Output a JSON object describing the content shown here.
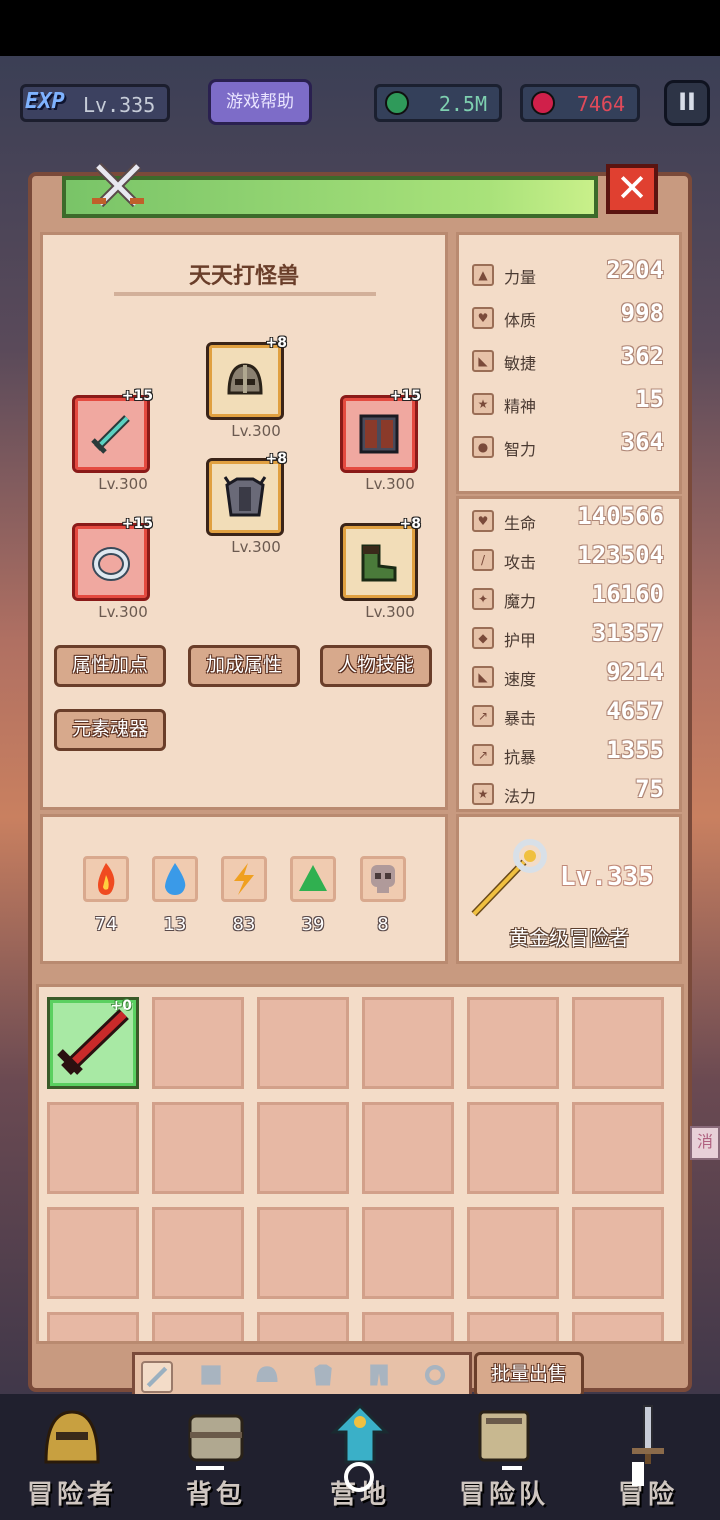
{
  "topbar": {
    "exp_tag": "EXP",
    "level": "Lv.335",
    "help_label": "游戏帮助",
    "gems": "2.5M",
    "gems_color": "#2f9a5a",
    "rubies": "7464",
    "rubies_color": "#d0204a",
    "pause_label": "II"
  },
  "hero": {
    "name": "天天打怪兽",
    "close_label": "✕"
  },
  "equipment": [
    {
      "slot": "helmet",
      "plus": "+8",
      "level": "Lv.300"
    },
    {
      "slot": "weapon",
      "plus": "+15",
      "level": "Lv.300"
    },
    {
      "slot": "shield",
      "plus": "+15",
      "level": "Lv.300"
    },
    {
      "slot": "armor",
      "plus": "+8",
      "level": "Lv.300"
    },
    {
      "slot": "ring",
      "plus": "+15",
      "level": "Lv.300"
    },
    {
      "slot": "boots",
      "plus": "+8",
      "level": "Lv.300"
    }
  ],
  "panel_buttons": {
    "attr_points": "属性加点",
    "bonus_attrs": "加成属性",
    "char_skills": "人物技能",
    "element_soul": "元素魂器"
  },
  "elements": [
    {
      "icon": "fire-icon",
      "value": "74",
      "color": "#f04a20"
    },
    {
      "icon": "water-icon",
      "value": "13",
      "color": "#3a9ae8"
    },
    {
      "icon": "lightning-icon",
      "value": "83",
      "color": "#f0a020"
    },
    {
      "icon": "earth-icon",
      "value": "39",
      "color": "#30b050"
    },
    {
      "icon": "dark-icon",
      "value": "8",
      "color": "#8a6a6a"
    }
  ],
  "attributes": [
    {
      "name": "力量",
      "value": "2204"
    },
    {
      "name": "体质",
      "value": "998"
    },
    {
      "name": "敏捷",
      "value": "362"
    },
    {
      "name": "精神",
      "value": "15"
    },
    {
      "name": "智力",
      "value": "364"
    }
  ],
  "stats": [
    {
      "name": "生命",
      "value": "140566"
    },
    {
      "name": "攻击",
      "value": "123504"
    },
    {
      "name": "魔力",
      "value": "16160"
    },
    {
      "name": "护甲",
      "value": "31357"
    },
    {
      "name": "速度",
      "value": "9214"
    },
    {
      "name": "暴击",
      "value": "4657"
    },
    {
      "name": "抗暴",
      "value": "1355"
    },
    {
      "name": "法力",
      "value": "75"
    }
  ],
  "class": {
    "level": "Lv.335",
    "title": "黄金级冒险者"
  },
  "inventory": {
    "first_item_plus": "+0",
    "sell_label": "批量出售"
  },
  "side_hint": "消",
  "bottom_nav": [
    {
      "label": "冒险者"
    },
    {
      "label": "背包"
    },
    {
      "label": "营地"
    },
    {
      "label": "冒险队"
    },
    {
      "label": "冒险"
    }
  ]
}
